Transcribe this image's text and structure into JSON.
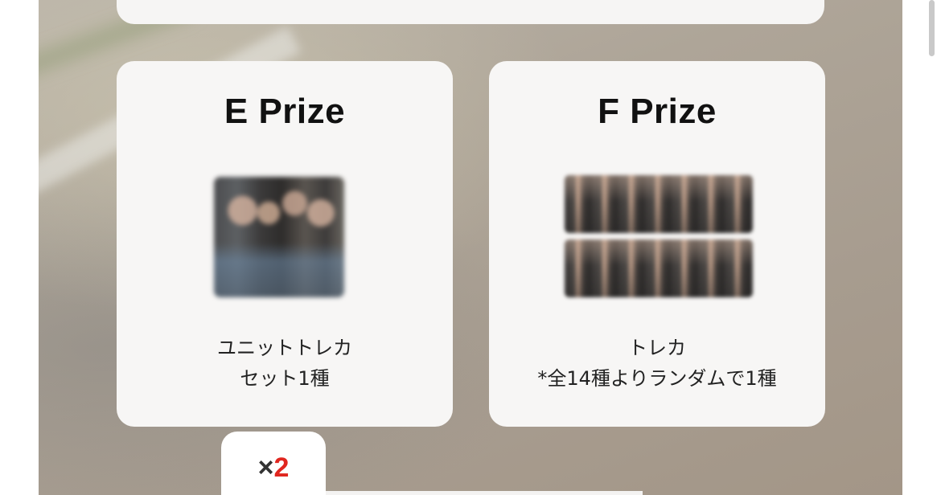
{
  "prizes": [
    {
      "title": "E Prize",
      "desc_line1": "ユニットトレカ",
      "desc_line2": "セット1種",
      "image": "blurred-unit-photo-card"
    },
    {
      "title": "F Prize",
      "desc_line1": "トレカ",
      "desc_line2": "*全14種よりランダムで1種",
      "image": "blurred-photo-card-strips"
    }
  ],
  "quantity": {
    "multiplier_symbol": "×",
    "count": "2"
  },
  "colors": {
    "card_bg": "#f7f6f5",
    "quantity_accent": "#e0261f",
    "title_text": "#111111"
  }
}
